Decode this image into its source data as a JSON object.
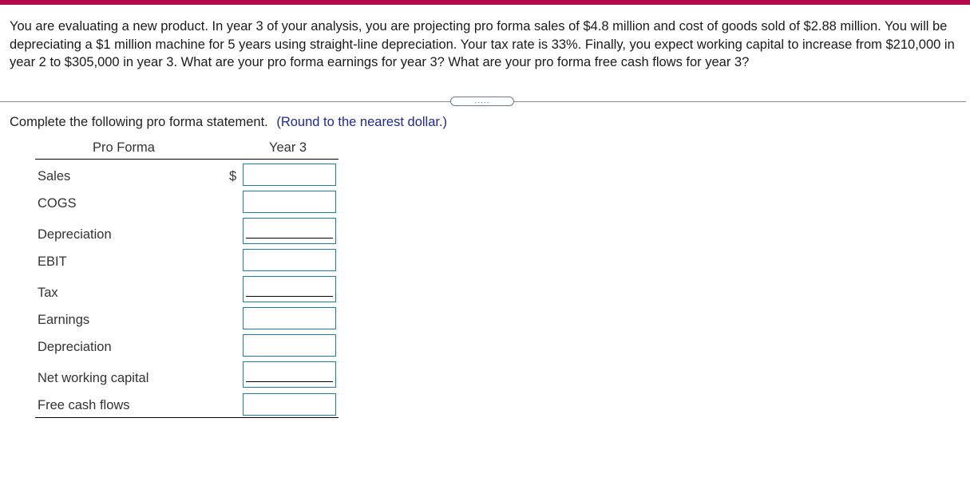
{
  "header": {
    "accent_color": "#b30d4b"
  },
  "question": {
    "text": "You are evaluating a new product. In year 3 of your analysis, you are projecting pro forma sales of $4.8 million and cost of goods sold of $2.88 million. You will be depreciating a $1 million machine for 5 years using straight-line depreciation. Your tax rate is 33%. Finally, you expect working capital to increase from $210,000 in year 2 to $305,000 in year 3. What are your pro forma earnings for year 3? What are your pro forma free cash flows for year 3?"
  },
  "expand_button": {
    "label": "....."
  },
  "instruction": {
    "text": "Complete the following pro forma statement.",
    "hint": "(Round to the nearest dollar.)"
  },
  "table": {
    "col_label": "Pro Forma",
    "col_year": "Year 3",
    "currency_symbol": "$",
    "rows": [
      {
        "label": "Sales",
        "value": ""
      },
      {
        "label": "COGS",
        "value": ""
      },
      {
        "label": "Depreciation",
        "value": ""
      },
      {
        "label": "EBIT",
        "value": ""
      },
      {
        "label": "Tax",
        "value": ""
      },
      {
        "label": "Earnings",
        "value": ""
      },
      {
        "label": "Depreciation",
        "value": ""
      },
      {
        "label": "Net working capital",
        "value": ""
      },
      {
        "label": "Free cash flows",
        "value": ""
      }
    ]
  }
}
